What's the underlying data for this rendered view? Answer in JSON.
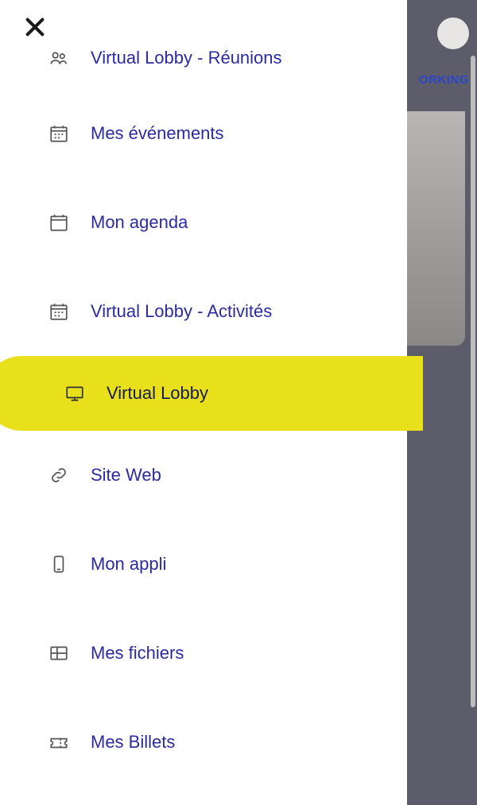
{
  "background": {
    "tab_fragment": "ORKING"
  },
  "menu": {
    "items": [
      {
        "icon": "people",
        "label": "Virtual Lobby - Réunions",
        "highlighted": false
      },
      {
        "icon": "calendar-grid",
        "label": "Mes événements",
        "highlighted": false
      },
      {
        "icon": "calendar",
        "label": "Mon agenda",
        "highlighted": false
      },
      {
        "icon": "calendar-grid",
        "label": "Virtual Lobby - Activités",
        "highlighted": false
      },
      {
        "icon": "monitor",
        "label": "Virtual Lobby",
        "highlighted": true
      },
      {
        "icon": "link",
        "label": "Site Web",
        "highlighted": false
      },
      {
        "icon": "phone",
        "label": "Mon appli",
        "highlighted": false
      },
      {
        "icon": "table",
        "label": "Mes fichiers",
        "highlighted": false
      },
      {
        "icon": "ticket",
        "label": "Mes Billets",
        "highlighted": false
      }
    ]
  }
}
